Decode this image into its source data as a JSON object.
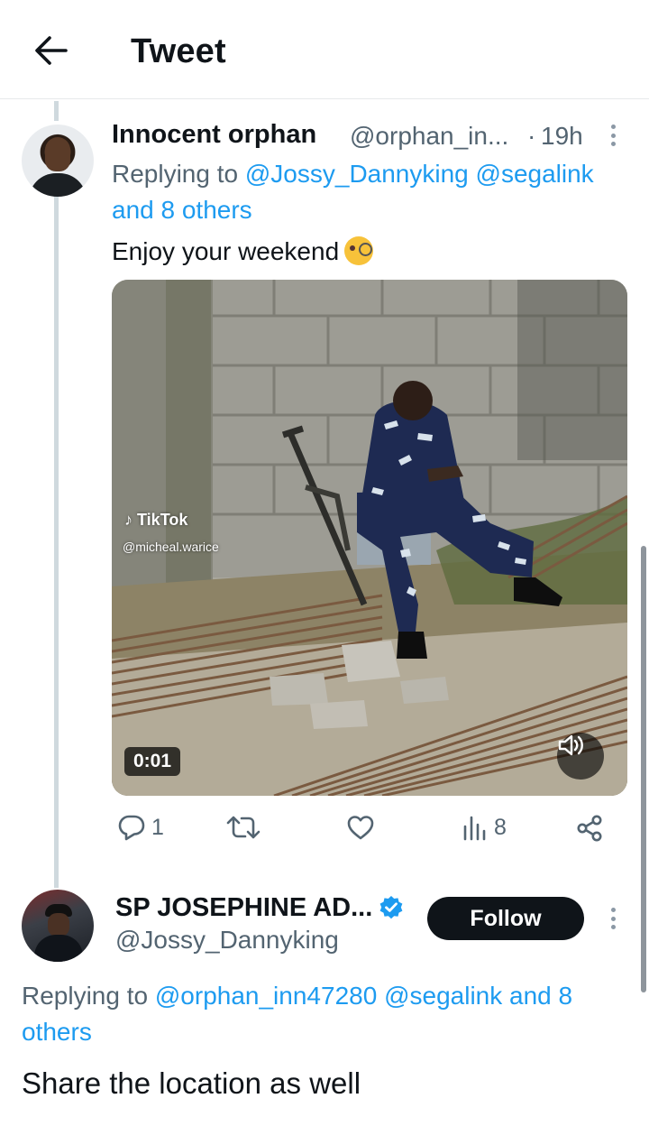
{
  "header": {
    "title": "Tweet",
    "back_icon": "arrow-left-icon"
  },
  "tweet1": {
    "author_name": "Innocent orphan",
    "author_handle": "@orphan_in...",
    "separator": "·",
    "time": "19h",
    "replying_prefix": "Replying to",
    "replying_mentions": [
      "@Jossy_Dannyking",
      "@segalink",
      "and 8 others"
    ],
    "text": "Enjoy your weekend",
    "emoji": "face-with-monocle",
    "media": {
      "watermark_brand": "TikTok",
      "watermark_user": "@micheal.warice",
      "duration": "0:01",
      "volume_icon": "speaker-icon"
    },
    "actions": {
      "replies": "1",
      "retweets": "",
      "likes": "",
      "views": "8"
    }
  },
  "tweet2": {
    "author_name": "SP JOSEPHINE AD...",
    "verified": true,
    "author_handle": "@Jossy_Dannyking",
    "follow_label": "Follow",
    "replying_prefix": "Replying to",
    "replying_mentions": [
      "@orphan_inn47280",
      "@segalink",
      "and 8",
      "others"
    ],
    "text": "Share the location as well"
  },
  "colors": {
    "link": "#1d9bf0",
    "secondary_text": "#536471",
    "primary_text": "#0f1419",
    "follow_bg": "#0f1419"
  }
}
